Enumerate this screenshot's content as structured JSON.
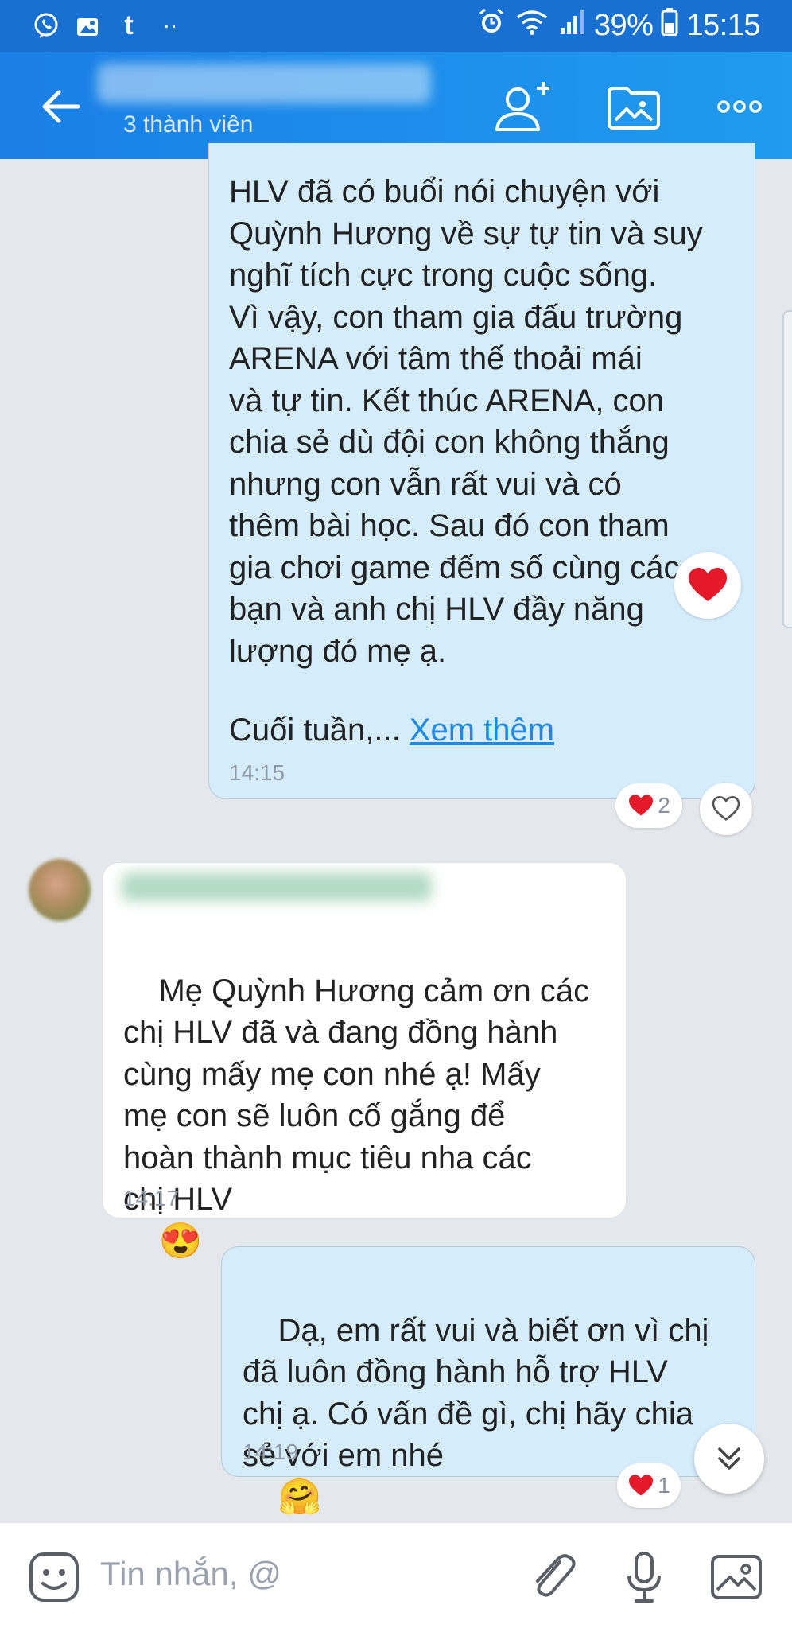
{
  "status_bar": {
    "left_icons": [
      "viber-icon",
      "gallery-icon",
      "tumblr-icon",
      "more-dots-icon"
    ],
    "tumblr_glyph": "t",
    "dots": "··",
    "battery": "39%",
    "time": "15:15"
  },
  "header": {
    "subtitle": "3 thành viên",
    "accent": "#1a7fe6"
  },
  "messages": [
    {
      "id": "m1",
      "from": "me",
      "text": "HLV đã có buổi nói chuyện với\nQuỳnh Hương về sự tự tin và suy\nnghĩ tích cực trong cuộc sống.\nVì vậy, con tham gia đấu trường\nARENA với tâm thế thoải mái\nvà tự tin. Kết thúc ARENA, con\nchia sẻ dù đội con không thắng\nnhưng con vẫn rất vui và có\nthêm bài học. Sau đó con tham\ngia chơi game đếm số cùng các\nbạn và anh chị HLV đầy năng\nlượng đó mẹ ạ.",
      "more_prefix": "Cuối tuần,... ",
      "more_link": "Xem thêm",
      "time": "14:15",
      "reaction_count": "2"
    },
    {
      "id": "m2",
      "from": "other",
      "text": "Mẹ Quỳnh Hương cảm ơn các\nchị HLV đã và đang đồng hành\ncùng mấy mẹ con nhé ạ! Mấy\nmẹ con sẽ luôn cố gắng để\nhoàn thành mục tiêu nha các\nchị HLV",
      "emoji": "😍",
      "time": "14:17"
    },
    {
      "id": "m3",
      "from": "me",
      "text": "Dạ, em rất vui và biết ơn vì chị\nđã luôn đồng hành hỗ trợ HLV\nchị ạ. Có vấn đề gì, chị hãy chia\nsẻ với em nhé",
      "emoji": "🤗",
      "time": "14:19",
      "reaction_count": "1"
    }
  ],
  "input": {
    "placeholder": "Tin nhắn, @"
  }
}
